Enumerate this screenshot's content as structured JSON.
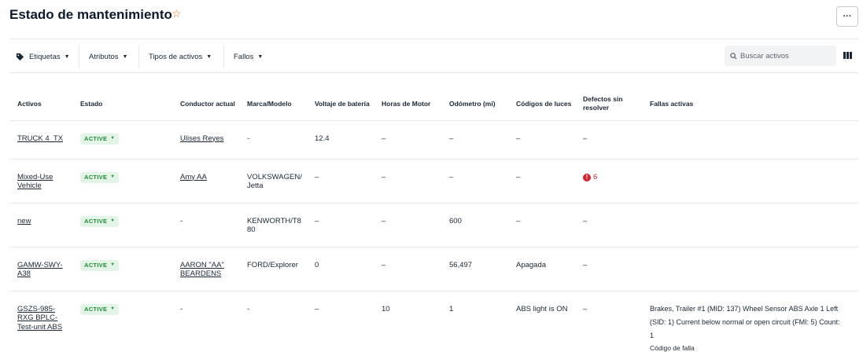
{
  "header": {
    "title": "Estado de mantenimiento",
    "favorite_icon": "star-outline-icon",
    "more_label": "···"
  },
  "filters": {
    "tags_label": "Etiquetas",
    "attributes_label": "Atributos",
    "asset_types_label": "Tipos de activos",
    "faults_label": "Fallos",
    "search_placeholder": "Buscar activos"
  },
  "table": {
    "headers": {
      "asset": "Activos",
      "status": "Estado",
      "driver": "Conductor actual",
      "make_model": "Marca/Modelo",
      "battery": "Voltaje de batería",
      "engine_hours": "Horas de Motor",
      "odometer": "Odómetro (mi)",
      "light_codes": "Códigos de luces",
      "defects": "Defectos sin resolver",
      "active_faults": "Fallas activas"
    },
    "rows": [
      {
        "asset": "TRUCK 4_TX",
        "status": "ACTIVE",
        "driver": "Ulises Reyes",
        "make_model": "-",
        "battery": "12.4",
        "engine_hours": "–",
        "odometer": "–",
        "light_codes": "–",
        "defects": "–",
        "faults": "",
        "fault_code_label": ""
      },
      {
        "asset": "Mixed-Use Vehicle",
        "status": "ACTIVE",
        "driver": "Amy AA",
        "make_model": "VOLKSWAGEN/Jetta",
        "battery": "–",
        "engine_hours": "–",
        "odometer": "–",
        "light_codes": "–",
        "defects": "6",
        "faults": "",
        "fault_code_label": ""
      },
      {
        "asset": "new",
        "status": "ACTIVE",
        "driver": "-",
        "make_model": "KENWORTH/T880",
        "battery": "–",
        "engine_hours": "–",
        "odometer": "600",
        "light_codes": "–",
        "defects": "–",
        "faults": "",
        "fault_code_label": ""
      },
      {
        "asset": "GAMW-SWY-A38",
        "status": "ACTIVE",
        "driver": "AARON \"AA\" BEARDENS",
        "make_model": "FORD/Explorer",
        "battery": "0",
        "engine_hours": "–",
        "odometer": "56,497",
        "light_codes": "Apagada",
        "defects": "–",
        "faults": "",
        "fault_code_label": ""
      },
      {
        "asset": "GSZS-985-RXG BPLC-Test-unit ABS",
        "status": "ACTIVE",
        "driver": "-",
        "make_model": "-",
        "battery": "–",
        "engine_hours": "10",
        "odometer": "1",
        "light_codes": "ABS light is ON",
        "defects": "–",
        "faults": "Brakes, Trailer #1 (MID: 137) Wheel Sensor ABS Axle 1 Left (SID: 1) Current below normal or open circuit (FMI: 5) Count: 1",
        "fault_code_label": "Código de falla"
      }
    ]
  },
  "colors": {
    "active_badge_bg": "#e3f5e6",
    "active_badge_text": "#1e8b3a",
    "defect_red": "#d5232f",
    "star_orange": "#e07a1f"
  }
}
